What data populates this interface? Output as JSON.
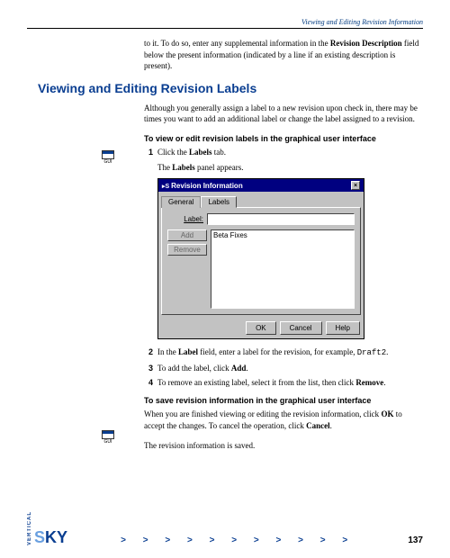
{
  "header": {
    "running_title": "Viewing and Editing Revision Information"
  },
  "intro": {
    "text_before": "to it. To do so, enter any supplemental information in the ",
    "bold": "Revision Description",
    "text_after": " field below the present information (indicated by a line if an existing description is present)."
  },
  "section": {
    "heading": "Viewing and Editing Revision Labels",
    "para": "Although you generally assign a label to a new revision upon check in, there may be times you want to add an additional label or change the label assigned to a revision.",
    "task1_title": "To view or edit revision labels in the graphical user interface",
    "gui_label": "GUI",
    "step1_a": "Click the ",
    "step1_bold": "Labels",
    "step1_b": " tab.",
    "step1_note_a": "The ",
    "step1_note_bold": "Labels",
    "step1_note_b": " panel appears.",
    "step2_a": "In the ",
    "step2_bold": "Label",
    "step2_b": " field, enter a label for the revision, for example, ",
    "step2_code": "Draft2",
    "step2_c": ".",
    "step3_a": "To add the label, click ",
    "step3_bold": "Add",
    "step3_b": ".",
    "step4_a": "To remove an existing label, select it from the list, then click ",
    "step4_bold": "Remove",
    "step4_b": ".",
    "task2_title": "To save revision information in the graphical user interface",
    "task2_para_a": "When you are finished viewing or editing the revision information, click ",
    "task2_bold1": "OK",
    "task2_para_b": " to accept the changes. To cancel the operation, click ",
    "task2_bold2": "Cancel",
    "task2_para_c": ".",
    "task2_note": "The revision information is saved."
  },
  "dialog": {
    "title": "Revision Information",
    "tab_general": "General",
    "tab_labels": "Labels",
    "field_label": "Label:",
    "btn_add": "Add",
    "btn_remove": "Remove",
    "list_item": "Beta Fixes",
    "btn_ok": "OK",
    "btn_cancel": "Cancel",
    "btn_help": "Help"
  },
  "footer": {
    "vertical": "VERTICAL",
    "sky_s": "S",
    "sky_ky": "KY",
    "chevrons": ">   >   >   >   >   >   >   >   >   >   >",
    "page": "137"
  }
}
